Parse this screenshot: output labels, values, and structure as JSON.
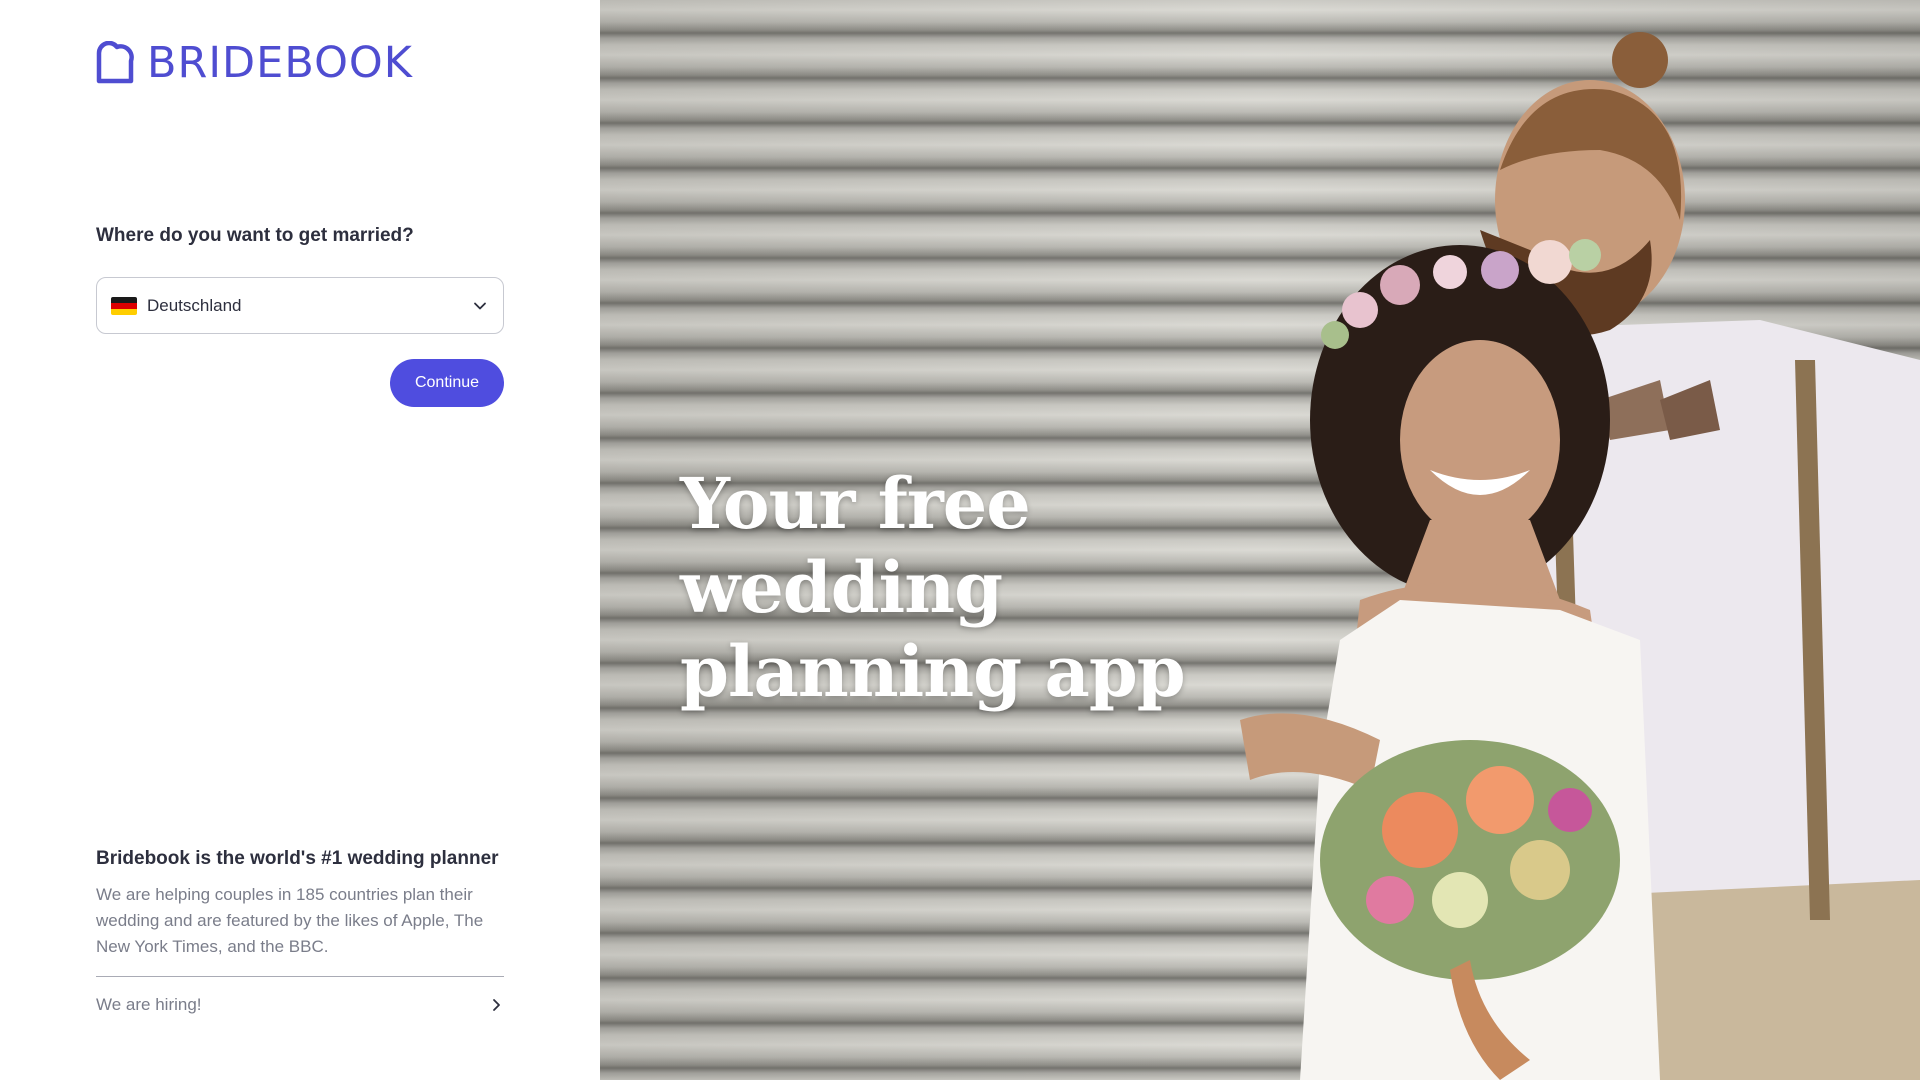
{
  "brand": {
    "name": "BRIDEBOOK",
    "color": "#4f4dd1"
  },
  "form": {
    "question": "Where do you want to get married?",
    "country": {
      "selected": "Deutschland",
      "flag_icon": "germany-flag-icon"
    },
    "continue_label": "Continue"
  },
  "about": {
    "title": "Bridebook is the world's #1 wedding planner",
    "text": "We are helping couples in 185 countries plan their wedding and are featured by the likes of Apple, The New York Times, and the BBC."
  },
  "hiring": {
    "label": "We are hiring!"
  },
  "hero": {
    "title": "Your free wedding planning app"
  },
  "colors": {
    "accent": "#4f4ddf",
    "text_dark": "#2d2f3e",
    "text_muted": "#7a7d8a"
  }
}
